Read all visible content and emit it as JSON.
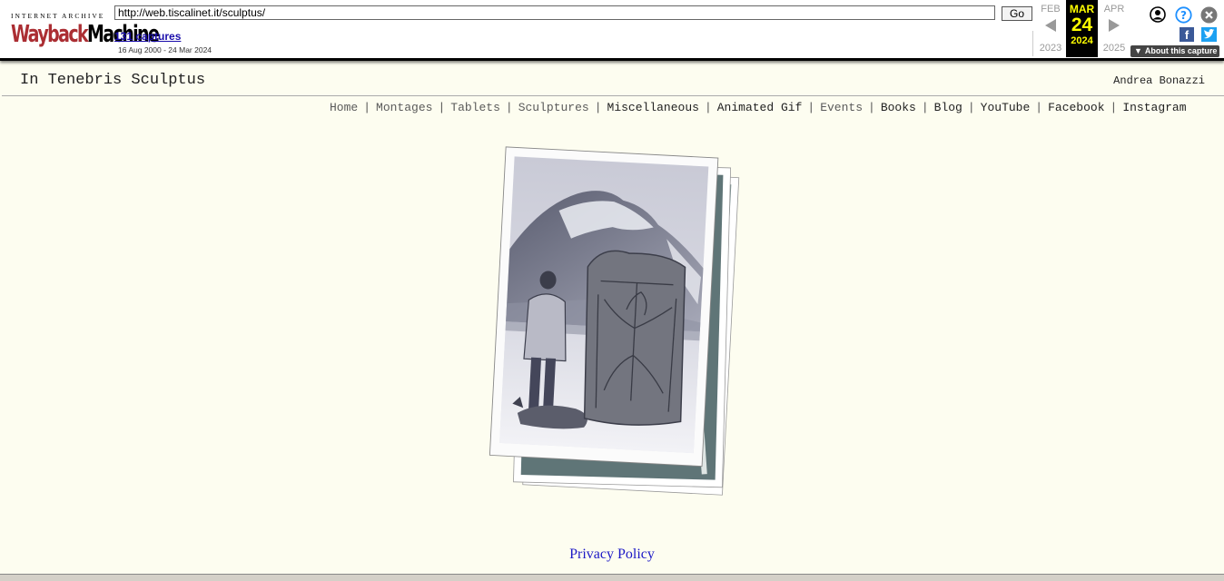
{
  "wayback": {
    "logo_top": "INTERNET ARCHIVE",
    "logo_word_a": "Wayback",
    "logo_word_b": "Machine",
    "url_value": "http://web.tiscalinet.it/sculptus/",
    "go_label": "Go",
    "captures_label": "131 captures",
    "date_range": "16 Aug 2000 - 24 Mar 2024",
    "calendar": {
      "prev": {
        "month": "FEB",
        "year": "2023"
      },
      "current": {
        "month": "MAR",
        "day": "24",
        "year": "2024"
      },
      "next": {
        "month": "APR",
        "year": "2025"
      }
    },
    "about_label": "About this capture",
    "icons": [
      "user-icon",
      "help-icon",
      "close-icon",
      "facebook-icon",
      "twitter-icon"
    ],
    "accent_color": "#ffff00",
    "logo_red": "#ab2e33"
  },
  "site": {
    "title": "In Tenebris Sculptus",
    "author": "Andrea Bonazzi",
    "nav": [
      {
        "label": "Home",
        "muted": true
      },
      {
        "label": "Montages",
        "muted": true
      },
      {
        "label": "Tablets",
        "muted": true
      },
      {
        "label": "Sculptures",
        "muted": true
      },
      {
        "label": "Miscellaneous",
        "muted": false
      },
      {
        "label": "Animated Gif",
        "muted": false
      },
      {
        "label": "Events",
        "muted": true
      },
      {
        "label": "Books",
        "muted": false
      },
      {
        "label": "Blog",
        "muted": false
      },
      {
        "label": "YouTube",
        "muted": false
      },
      {
        "label": "Facebook",
        "muted": false
      },
      {
        "label": "Instagram",
        "muted": false
      }
    ],
    "nav_separator": "|",
    "footer_link": "Privacy Policy",
    "background": "#fdfdf0",
    "link_color": "#1c18c6"
  }
}
